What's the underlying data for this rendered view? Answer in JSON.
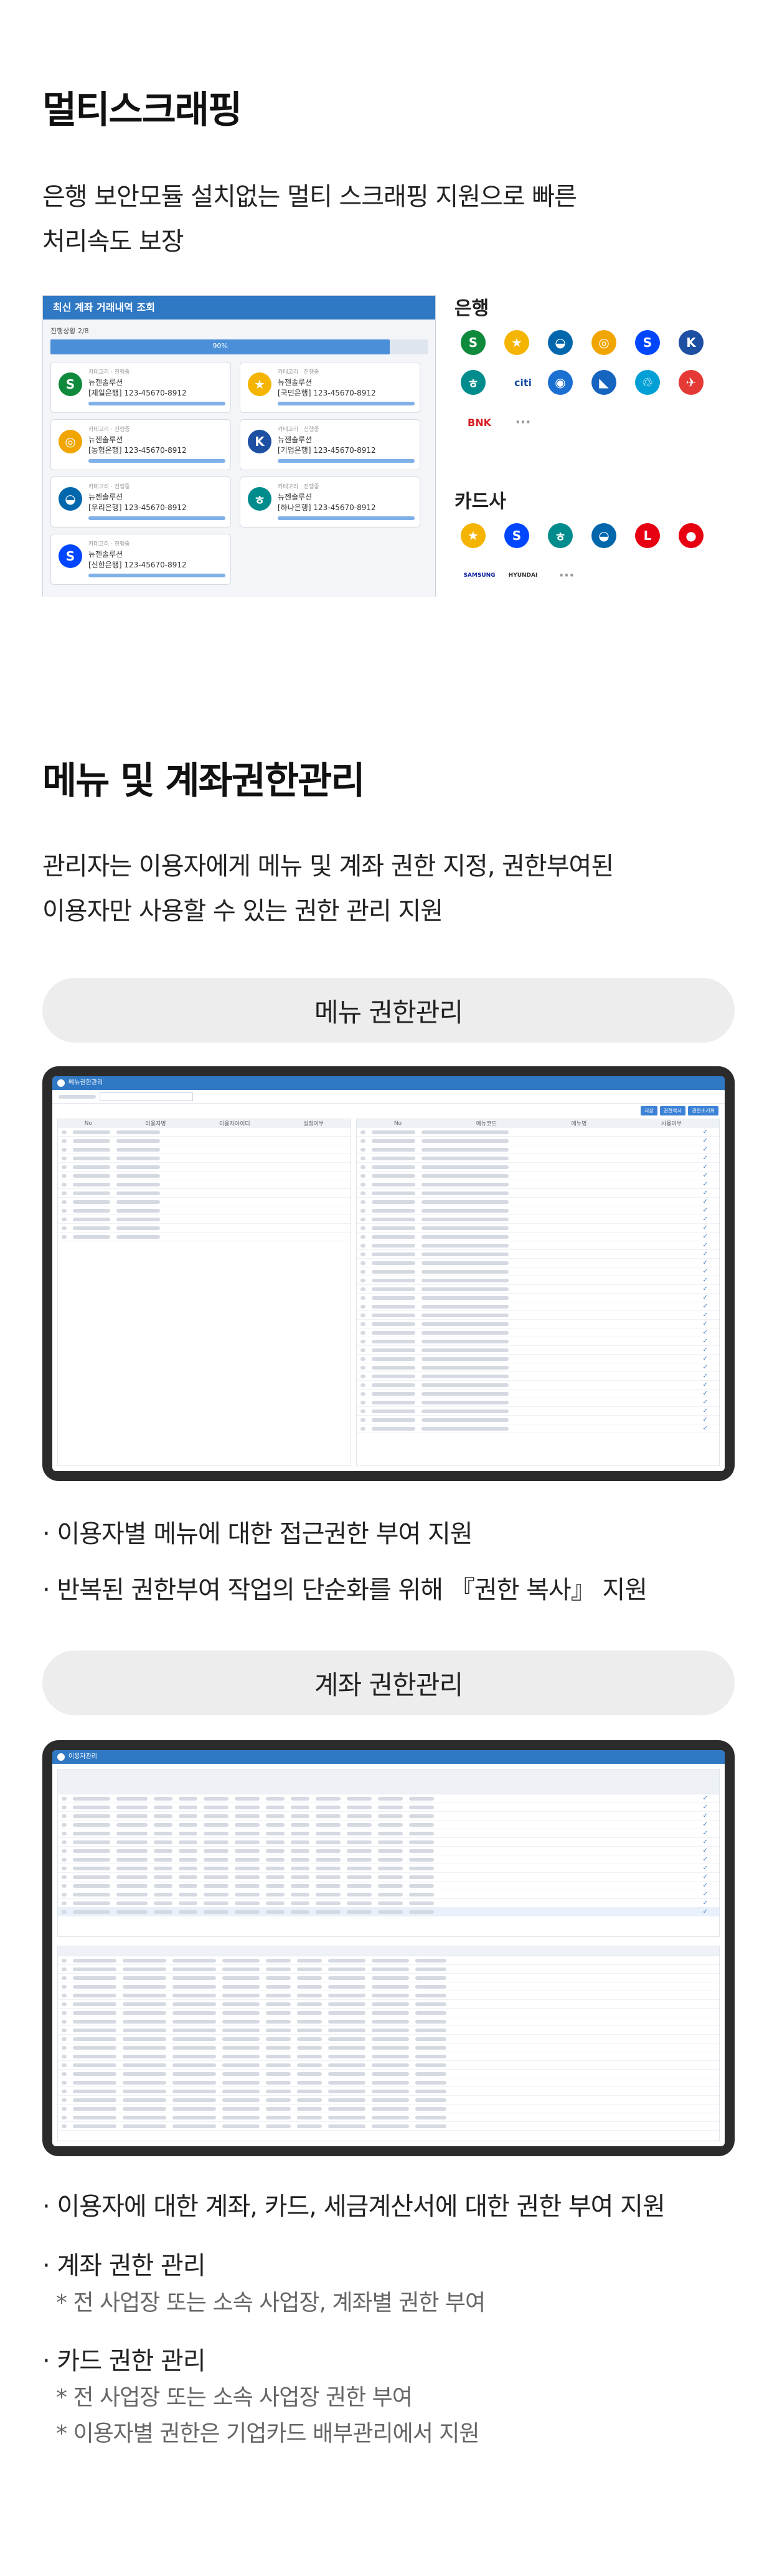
{
  "section1": {
    "title": "멀티스크래핑",
    "desc": [
      "은행 보안모듈 설치없는 멀티 스크래핑 지원으로 빠른",
      "처리속도 보장"
    ],
    "window": {
      "title": "최신 계좌 거래내역 조회",
      "progress_label": "진행상황 2/8",
      "progress_value": "90%",
      "progress_fraction": 0.9,
      "accounts": [
        {
          "meta": "카테고리 · 진행중",
          "holder": "뉴젠솔루션",
          "account": "[제일은행] 123-45670-8912",
          "logo": "sc",
          "color": "#0f8a3c",
          "glyph": "S"
        },
        {
          "meta": "카테고리 · 진행중",
          "holder": "뉴젠솔루션",
          "account": "[국민은행] 123-45670-8912",
          "logo": "kb",
          "color": "#f4b400",
          "glyph": "★"
        },
        {
          "meta": "카테고리 · 진행중",
          "holder": "뉴젠솔루션",
          "account": "[농협은행] 123-45670-8912",
          "logo": "nh",
          "color": "#f0a500",
          "glyph": "◎"
        },
        {
          "meta": "카테고리 · 진행중",
          "holder": "뉴젠솔루션",
          "account": "[기업은행] 123-45670-8912",
          "logo": "ibk",
          "color": "#1d4fa3",
          "glyph": "K"
        },
        {
          "meta": "카테고리 · 진행중",
          "holder": "뉴젠솔루션",
          "account": "[우리은행] 123-45670-8912",
          "logo": "woori",
          "color": "#0067ac",
          "glyph": "◒"
        },
        {
          "meta": "카테고리 · 진행중",
          "holder": "뉴젠솔루션",
          "account": "[하나은행] 123-45670-8912",
          "logo": "hana",
          "color": "#008c8c",
          "glyph": "ㅎ"
        },
        {
          "meta": "카테고리 · 진행중",
          "holder": "뉴젠솔루션",
          "account": "[신한은행] 123-45670-8912",
          "logo": "shinhan",
          "color": "#0046ff",
          "glyph": "S"
        }
      ]
    },
    "banks_label": "은행",
    "banks": [
      {
        "name": "sc-logo",
        "color": "#0f8a3c",
        "glyph": "S"
      },
      {
        "name": "kb-logo",
        "color": "#f4b400",
        "glyph": "★"
      },
      {
        "name": "woori-logo",
        "color": "#0067ac",
        "glyph": "◒"
      },
      {
        "name": "nh-logo",
        "color": "#f0a500",
        "glyph": "◎"
      },
      {
        "name": "shinhan-logo",
        "color": "#0046ff",
        "glyph": "S"
      },
      {
        "name": "ibk-logo",
        "color": "#1d4fa3",
        "glyph": "K"
      },
      {
        "name": "hana-logo",
        "color": "#008c8c",
        "glyph": "ㅎ"
      },
      {
        "name": "citi-logo",
        "color": "#1b4fa0",
        "glyph": "citi"
      },
      {
        "name": "kdb-logo",
        "color": "#1a6fd1",
        "glyph": "◉"
      },
      {
        "name": "suhyup-logo",
        "color": "#1565c0",
        "glyph": "◣"
      },
      {
        "name": "post-logo",
        "color": "#00a0d6",
        "glyph": "♲"
      },
      {
        "name": "dgb-logo",
        "color": "#e53935",
        "glyph": "✈"
      },
      {
        "name": "bnk-logo",
        "color": "#d71920",
        "glyph": "BNK"
      },
      {
        "name": "more-icon",
        "color": "#999999",
        "glyph": "···"
      }
    ],
    "cards_label": "카드사",
    "cards": [
      {
        "name": "kb-card-logo",
        "color": "#f4b400",
        "glyph": "★"
      },
      {
        "name": "shinhan-card-logo",
        "color": "#0046ff",
        "glyph": "S"
      },
      {
        "name": "hana-card-logo",
        "color": "#008c8c",
        "glyph": "ㅎ"
      },
      {
        "name": "woori-card-logo",
        "color": "#0067ac",
        "glyph": "◒"
      },
      {
        "name": "lotte-card-logo",
        "color": "#e60012",
        "glyph": "L"
      },
      {
        "name": "bc-card-logo",
        "color": "#e60012",
        "glyph": "●"
      },
      {
        "name": "samsung-card-logo",
        "color": "#1428a0",
        "glyph": "SAMSUNG"
      },
      {
        "name": "hyundai-card-logo",
        "color": "#333333",
        "glyph": "HYUNDAI"
      },
      {
        "name": "more-icon",
        "color": "#999999",
        "glyph": "···"
      }
    ]
  },
  "section2": {
    "title": "메뉴 및 계좌권한관리",
    "desc": [
      "관리자는 이용자에게 메뉴 및 계좌 권한 지정, 권한부여된",
      "이용자만 사용할 수 있는 권한 관리 지원"
    ],
    "menu_pill": "메뉴 권한관리",
    "menu_screen": {
      "title": "메뉴권한관리",
      "left_headers": [
        "No",
        "이용자명",
        "이용자아이디",
        "설정여부"
      ],
      "right_headers": [
        "No",
        "메뉴코드",
        "메뉴명",
        "사용여부"
      ],
      "buttons": [
        "저장",
        "권한복사",
        "권한초기화"
      ]
    },
    "menu_bullets": [
      "· 이용자별 메뉴에 대한 접근권한 부여 지원",
      "· 반복된 권한부여 작업의 단순화를 위해 『권한 복사』 지원"
    ],
    "account_pill": "계좌 권한관리",
    "account_screen": {
      "title": "이용자관리"
    },
    "account_bullets": [
      {
        "text": "· 이용자에 대한 계좌, 카드, 세금계산서에 대한 권한 부여 지원",
        "subs": []
      },
      {
        "text": "· 계좌 권한 관리",
        "subs": [
          "* 전 사업장 또는 소속 사업장, 계좌별 권한 부여"
        ]
      },
      {
        "text": "· 카드 권한 관리",
        "subs": [
          "* 전 사업장 또는 소속 사업장 권한 부여",
          "* 이용자별 권한은 기업카드 배부관리에서 지원"
        ]
      }
    ]
  }
}
